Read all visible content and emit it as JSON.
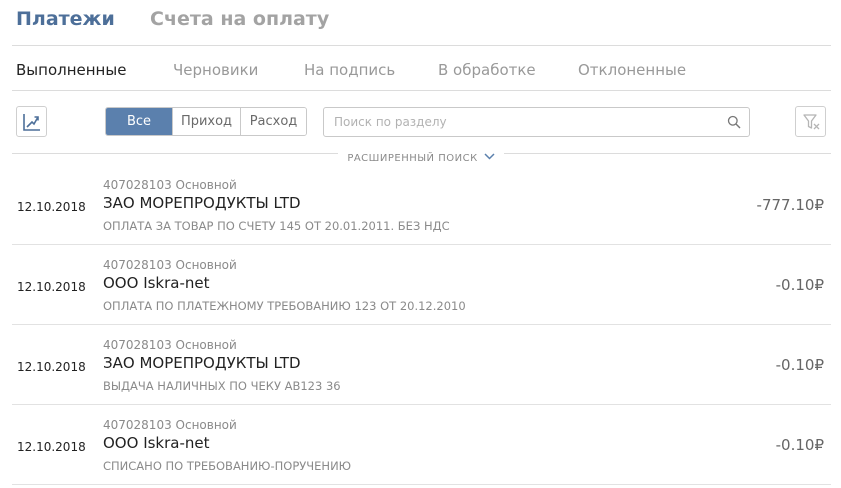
{
  "top_tabs": {
    "payments": "Платежи",
    "invoices": "Счета на оплату"
  },
  "sub_tabs": {
    "executed": "Выполненные",
    "drafts": "Черновики",
    "to_sign": "На подпись",
    "processing": "В обработке",
    "rejected": "Отклоненные"
  },
  "filter": {
    "all": "Все",
    "income": "Приход",
    "expense": "Расход"
  },
  "search": {
    "placeholder": "Поиск по разделу"
  },
  "advanced_search": {
    "label": "РАСШИРЕННЫЙ ПОИСК"
  },
  "colors": {
    "accent": "#5b80ad",
    "title": "#4d6f99",
    "muted": "#8a8a8a"
  },
  "icons": [
    "trend-chart-icon",
    "search-icon",
    "chevron-down-icon",
    "filter-clear-icon",
    "ruble-icon"
  ],
  "transactions": [
    {
      "date": "12.10.2018",
      "account": "407028103 Основной",
      "party": "ЗАО МОРЕПРОДУКТЫ LTD",
      "purpose": "ОПЛАТА ЗА ТОВАР ПО СЧЕТУ 145 ОТ 20.01.2011. БЕЗ НДС",
      "amount": "-777.10₽"
    },
    {
      "date": "12.10.2018",
      "account": "407028103 Основной",
      "party": "ООО Iskra-net",
      "purpose": "ОПЛАТА ПО ПЛАТЕЖНОМУ ТРЕБОВАНИЮ 123 ОТ 20.12.2010",
      "amount": "-0.10₽"
    },
    {
      "date": "12.10.2018",
      "account": "407028103 Основной",
      "party": "ЗАО МОРЕПРОДУКТЫ LTD",
      "purpose": "ВЫДАЧА НАЛИЧНЫХ ПО ЧЕКУ АВ123 36",
      "amount": "-0.10₽"
    },
    {
      "date": "12.10.2018",
      "account": "407028103 Основной",
      "party": "ООО Iskra-net",
      "purpose": "СПИСАНО ПО ТРЕБОВАНИЮ-ПОРУЧЕНИЮ",
      "amount": "-0.10₽"
    }
  ]
}
